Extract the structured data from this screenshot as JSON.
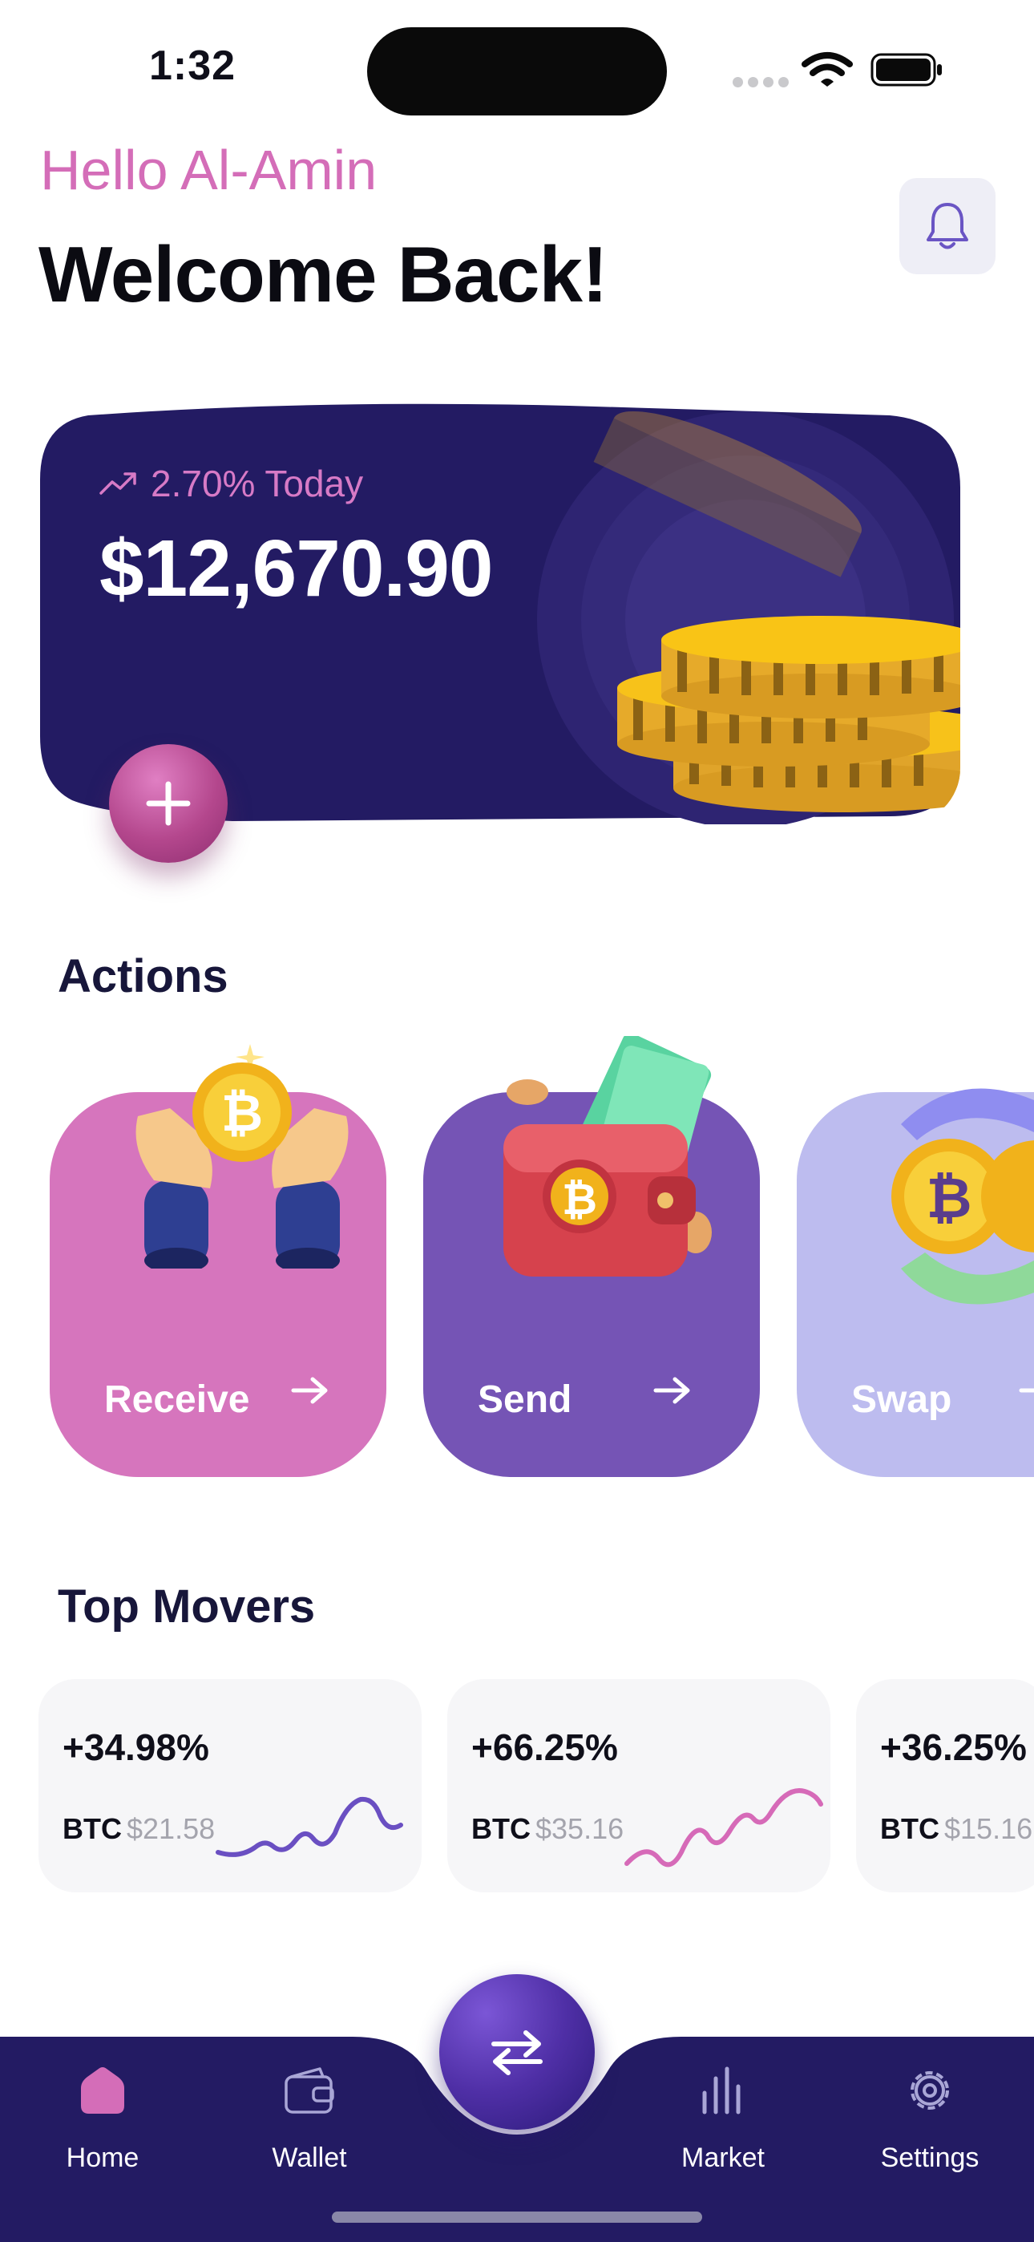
{
  "status_bar": {
    "time": "1:32"
  },
  "header": {
    "greeting": "Hello Al-Amin",
    "title": "Welcome Back!"
  },
  "balance": {
    "change": "2.70% Today",
    "amount": "$12,670.90"
  },
  "actions": {
    "title": "Actions",
    "items": [
      {
        "label": "Receive",
        "color": "#d675bd"
      },
      {
        "label": "Send",
        "color": "#7554b5"
      },
      {
        "label": "Swap",
        "color": "#bdbcef"
      }
    ]
  },
  "movers": {
    "title": "Top Movers",
    "items": [
      {
        "change": "+34.98%",
        "symbol": "BTC",
        "price": "$21.58",
        "line_color": "#6a4fc2"
      },
      {
        "change": "+66.25%",
        "symbol": "BTC",
        "price": "$35.16",
        "line_color": "#d66ab8"
      },
      {
        "change": "+36.25%",
        "symbol": "BTC",
        "price": "$15.16",
        "line_color": "#6a4fc2"
      }
    ]
  },
  "nav": {
    "items": [
      {
        "label": "Home",
        "icon": "home-icon",
        "active": true
      },
      {
        "label": "Wallet",
        "icon": "wallet-icon"
      },
      {
        "label": "Market",
        "icon": "bar-chart-icon"
      },
      {
        "label": "Settings",
        "icon": "gear-icon"
      }
    ],
    "center_icon": "swap-arrows-icon"
  },
  "colors": {
    "brand_dark": "#231b63",
    "accent_pink": "#d46db8",
    "accent_purple": "#7554b5",
    "lavender": "#bdbcef"
  }
}
